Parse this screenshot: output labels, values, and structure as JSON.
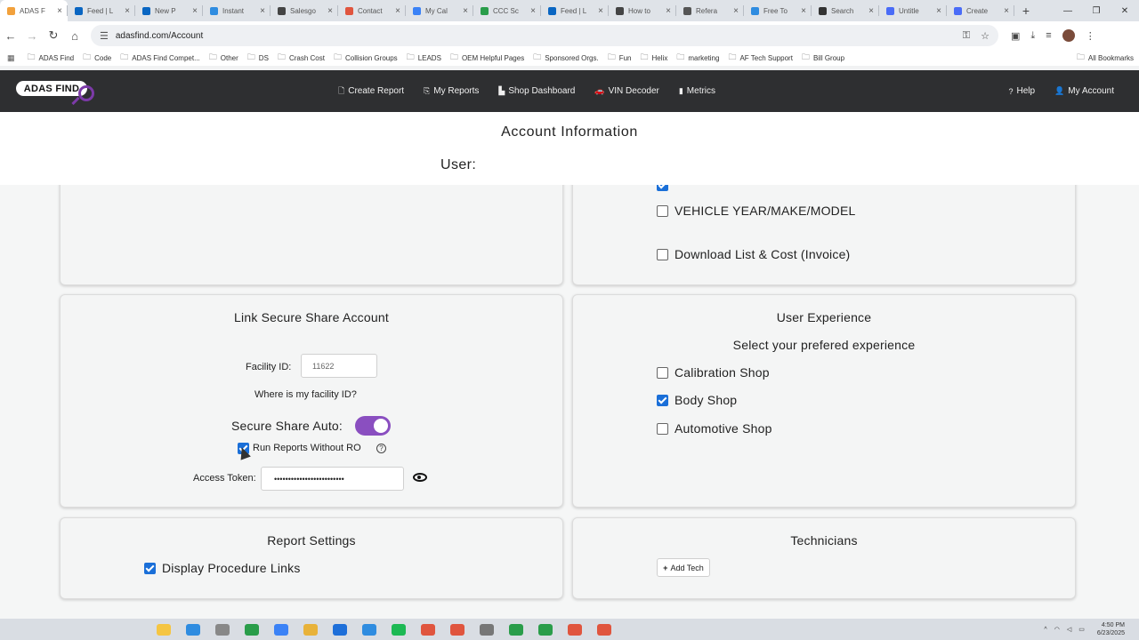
{
  "browser": {
    "tabs": [
      {
        "title": "ADAS F",
        "color": "#f2a13c",
        "active": true
      },
      {
        "title": "Feed | L",
        "color": "#0a66c2"
      },
      {
        "title": "New P",
        "color": "#0a66c2"
      },
      {
        "title": "Instant",
        "color": "#2f8ce0"
      },
      {
        "title": "Salesgo",
        "color": "#444444"
      },
      {
        "title": "Contact",
        "color": "#e0553e"
      },
      {
        "title": "My Cal",
        "color": "#3b82f6"
      },
      {
        "title": "CCC Sc",
        "color": "#2a9d4a"
      },
      {
        "title": "Feed | L",
        "color": "#0a66c2"
      },
      {
        "title": "How to",
        "color": "#444444"
      },
      {
        "title": "Refera",
        "color": "#555555"
      },
      {
        "title": "Free To",
        "color": "#2f8ce0"
      },
      {
        "title": "Search",
        "color": "#333333"
      },
      {
        "title": "Untitle",
        "color": "#4a6cf7"
      },
      {
        "title": "Create",
        "color": "#4a6cf7"
      }
    ],
    "url": "adasfind.com/Account",
    "bookmarks": [
      "ADAS Find",
      "Code",
      "ADAS Find Compet...",
      "Other",
      "DS",
      "Crash Cost",
      "Collision Groups",
      "LEADS",
      "OEM Helpful Pages",
      "Sponsored Orgs.",
      "Fun",
      "Helix",
      "marketing",
      "AF Tech Support",
      "Bill Group"
    ],
    "all_bookmarks": "All Bookmarks"
  },
  "site": {
    "logo_text": "ADAS FIND",
    "nav": [
      "Create Report",
      "My Reports",
      "Shop Dashboard",
      "VIN Decoder",
      "Metrics"
    ],
    "help": "Help",
    "account": "My Account"
  },
  "account": {
    "title": "Account Information",
    "user_label": "User:"
  },
  "top_right_card": {
    "options": [
      {
        "label": "VEHICLE YEAR/MAKE/MODEL",
        "checked": false
      },
      {
        "label": "Download List & Cost (Invoice)",
        "checked": false
      }
    ]
  },
  "secure_share": {
    "title": "Link Secure Share Account",
    "facility_label": "Facility ID:",
    "facility_value": "11622",
    "facility_help": "Where is my facility ID?",
    "auto_label": "Secure Share Auto:",
    "auto_on": true,
    "run_without_ro_label": "Run Reports Without RO",
    "run_without_ro_checked": true,
    "token_label": "Access Token:",
    "token_value": "•••••••••••••••••••••••••"
  },
  "user_experience": {
    "title": "User Experience",
    "subtitle": "Select your prefered experience",
    "options": [
      {
        "label": "Calibration Shop",
        "checked": false
      },
      {
        "label": "Body Shop",
        "checked": true
      },
      {
        "label": "Automotive Shop",
        "checked": false
      }
    ]
  },
  "report_settings": {
    "title": "Report Settings",
    "option": "Display Procedure Links",
    "checked": true
  },
  "technicians": {
    "title": "Technicians",
    "add_button": "Add Tech"
  },
  "taskbar": {
    "time": "4:50 PM",
    "date": "6/23/2025"
  },
  "colors": {
    "nav_bg": "#2e2f31",
    "accent_purple": "#8a4fc0",
    "checkbox_blue": "#1a6fd8"
  }
}
